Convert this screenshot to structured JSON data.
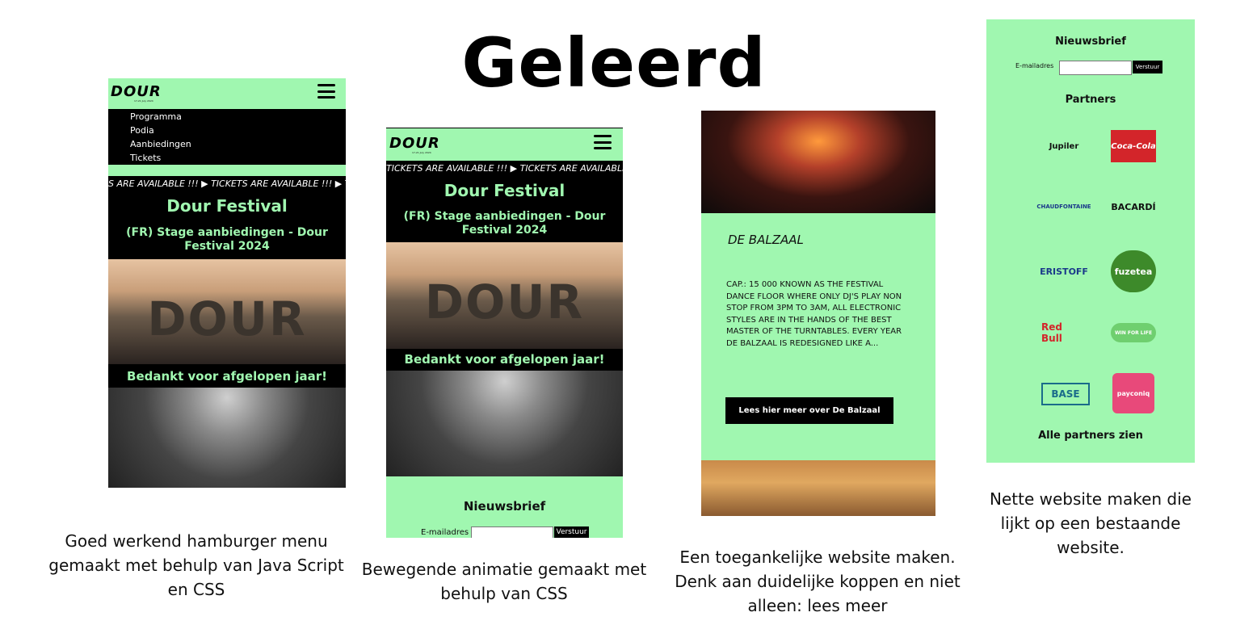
{
  "title": "Geleerd",
  "shot1": {
    "menu": [
      "Programma",
      "Podia",
      "Aanbiedingen",
      "Tickets"
    ],
    "marquee": "S ARE AVAILABLE !!! ▶ TICKETS ARE AVAILABLE !!! ▶ TIC",
    "heading": "Dour Festival",
    "subheading": "(FR) Stage aanbiedingen - Dour Festival 2024",
    "photo_text": "DOUR",
    "banner": "Bedankt voor afgelopen jaar!",
    "caption": "Goed werkend hamburger menu gemaakt met behulp van Java Script en CSS"
  },
  "shot2": {
    "marquee": "TICKETS ARE AVAILABLE !!! ▶ TICKETS ARE AVAILABLE !!!",
    "heading": "Dour Festival",
    "subheading": "(FR) Stage aanbiedingen - Dour Festival 2024",
    "photo_text": "DOUR",
    "banner": "Bedankt voor afgelopen jaar!",
    "newsletter_title": "Nieuwsbrief",
    "email_label": "E-mailadres",
    "submit": "Verstuur",
    "caption": "Bewegende animatie gemaakt met behulp van CSS"
  },
  "shot3": {
    "stage_heading": "DE BALZAAL",
    "body": "CAP.: 15 000 KNOWN AS THE FESTIVAL DANCE FLOOR WHERE ONLY DJ'S PLAY NON STOP FROM 3PM TO 3AM, ALL ELECTRONIC STYLES ARE IN THE HANDS OF THE BEST MASTER OF THE TURNTABLES. EVERY YEAR DE BALZAAL IS REDESIGNED LIKE A...",
    "read_more": "Lees hier meer over De Balzaal",
    "caption": "Een toegankelijke website maken. Denk aan duidelijke koppen en niet alleen: lees meer"
  },
  "shot4": {
    "newsletter_title": "Nieuwsbrief",
    "email_label": "E-mailadres",
    "submit": "Verstuur",
    "partners_title": "Partners",
    "partners": [
      "Jupiler",
      "Coca-Cola",
      "CHAUDFONTAINE",
      "BACARDÍ",
      "ERISTOFF",
      "fuzetea",
      "Red Bull",
      "WIN FOR LIFE",
      "BASE",
      "payconiq"
    ],
    "all_partners": "Alle partners zien",
    "caption": "Nette website maken die lijkt op een bestaande website."
  },
  "logo": "DOUR",
  "logo_date": "17-21 July 2024",
  "colors": {
    "accent_green": "#a0f7b0",
    "black": "#000000"
  }
}
